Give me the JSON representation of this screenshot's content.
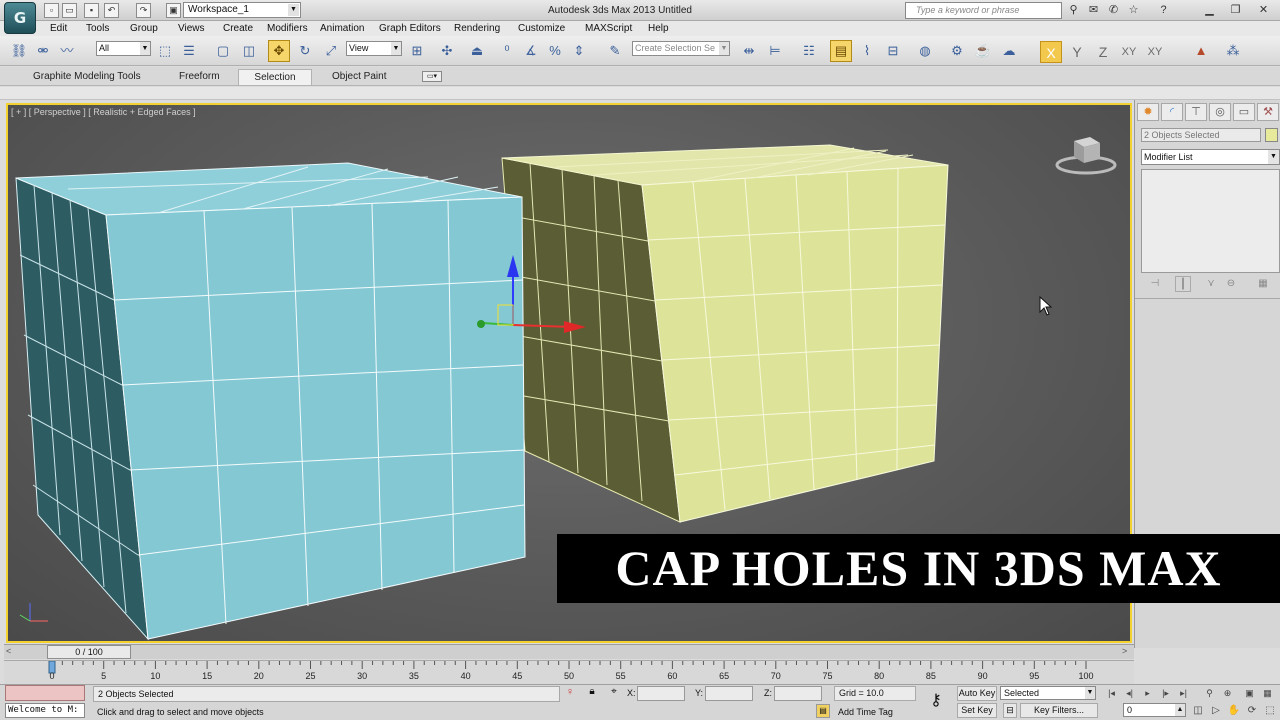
{
  "app": {
    "window_title": "Autodesk 3ds Max 2013     Untitled",
    "workspace": "Workspace_1",
    "help_search_placeholder": "Type a keyword or phrase"
  },
  "menu": [
    "Edit",
    "Tools",
    "Group",
    "Views",
    "Create",
    "Modifiers",
    "Animation",
    "Graph Editors",
    "Rendering",
    "Customize",
    "MAXScript",
    "Help"
  ],
  "toolbar": {
    "selection_filter": "All",
    "reference_coord": "View",
    "named_selection_placeholder": "Create Selection Se",
    "axis_constraints": [
      "X",
      "Y",
      "Z",
      "XY",
      "XY"
    ]
  },
  "ribbon": {
    "tabs": [
      "Graphite Modeling Tools",
      "Freeform",
      "Selection",
      "Object Paint"
    ],
    "selected_tab": "Selection"
  },
  "viewport": {
    "label": "[ + ] [ Perspective ] [ Realistic + Edged Faces ]",
    "objects": [
      {
        "name": "box-blue",
        "color": "#84c8d4"
      },
      {
        "name": "box-yellow",
        "color": "#dde49a"
      }
    ],
    "overlay_text": "CAP HOLES IN 3DS MAX"
  },
  "command_panel": {
    "object_name_placeholder": "2 Objects Selected",
    "modifier_list": "Modifier List"
  },
  "timeline": {
    "slider_label": "0 / 100",
    "current_frame": 0,
    "frame_range": [
      0,
      100
    ],
    "ticks": [
      0,
      5,
      10,
      15,
      20,
      25,
      30,
      35,
      40,
      45,
      50,
      55,
      60,
      65,
      70,
      75,
      80,
      85,
      90,
      95,
      100
    ]
  },
  "status": {
    "welcome": "Welcome to M:",
    "selection": "2 Objects Selected",
    "prompt": "Click and drag to select and move objects",
    "x_label": "X:",
    "y_label": "Y:",
    "z_label": "Z:",
    "grid": "Grid = 10.0",
    "add_time_tag": "Add Time Tag",
    "auto_key": "Auto Key",
    "set_key": "Set Key",
    "selected_filter": "Selected",
    "key_filters": "Key Filters...",
    "frame": "0"
  }
}
